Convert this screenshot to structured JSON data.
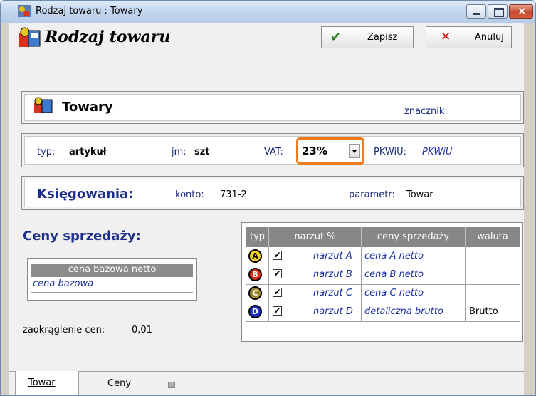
{
  "window": {
    "title": "Rodzaj towaru : Towary"
  },
  "header": {
    "title": "Rodzaj towaru",
    "save_label": "Zapisz",
    "cancel_label": "Anuluj"
  },
  "name_box": {
    "name": "Towary",
    "tag_label": "znacznik:",
    "tag_value": ""
  },
  "props": {
    "type_label": "typ:",
    "type_value": "artykuł",
    "unit_label": "jm:",
    "unit_value": "szt",
    "vat_label": "VAT:",
    "vat_value": "23%",
    "pkwiu_label": "PKWiU:",
    "pkwiu_value": "PKWiU"
  },
  "booking": {
    "title": "Księgowania:",
    "account_label": "konto:",
    "account_value": "731-2",
    "param_label": "parametr:",
    "param_value": "Towar"
  },
  "prices": {
    "title": "Ceny sprzedaży:",
    "base_header": "cena bazowa netto",
    "base_value": "cena bazowa",
    "rounding_label": "zaokrąglenie cen:",
    "rounding_value": "0,01"
  },
  "grid": {
    "headers": [
      "typ",
      "narzut %",
      "ceny sprzedaży",
      "waluta"
    ],
    "rows": [
      {
        "badge": "A",
        "color": "#f2d21a",
        "checked": "✔",
        "markup": "narzut A",
        "price": "cena A netto",
        "currency": ""
      },
      {
        "badge": "B",
        "color": "#e02a1a",
        "checked": "✔",
        "markup": "narzut B",
        "price": "cena B netto",
        "currency": ""
      },
      {
        "badge": "C",
        "color": "#9c8a2a",
        "checked": "✔",
        "markup": "narzut C",
        "price": "cena C netto",
        "currency": ""
      },
      {
        "badge": "D",
        "color": "#1e2fc8",
        "checked": "✔",
        "markup": "narzut D",
        "price": "detaliczna brutto",
        "currency": "Brutto"
      }
    ]
  },
  "tabs": [
    "Towar",
    "Ceny"
  ]
}
